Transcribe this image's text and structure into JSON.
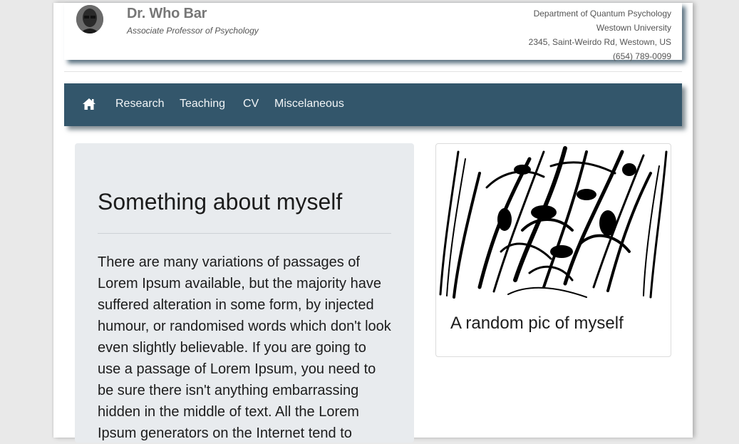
{
  "header": {
    "name": "Dr. Who Bar",
    "position": "Associate Professor of Psychology",
    "contact": {
      "department": "Department of Quantum Psychology",
      "university": "Westown University",
      "address": "2345, Saint-Weirdo Rd, Westown, US",
      "phone": "(654) 789-0099"
    },
    "avatar_icon": "profile-photo"
  },
  "nav": {
    "home_icon": "home-icon",
    "items": [
      "Research",
      "Teaching",
      "CV",
      "Miscelaneous"
    ],
    "background": "#33566b"
  },
  "about": {
    "heading": "Something about myself",
    "body": "There are many variations of passages of Lorem Ipsum available, but the majority have suffered alteration in some form, by injected humour, or randomised words which don't look even slightly believable. If you are going to use a passage of Lorem Ipsum, you need to be sure there isn't anything embarrassing hidden in the middle of text. All the Lorem Ipsum generators on the Internet tend to"
  },
  "picture_card": {
    "caption": "A random pic of myself"
  }
}
